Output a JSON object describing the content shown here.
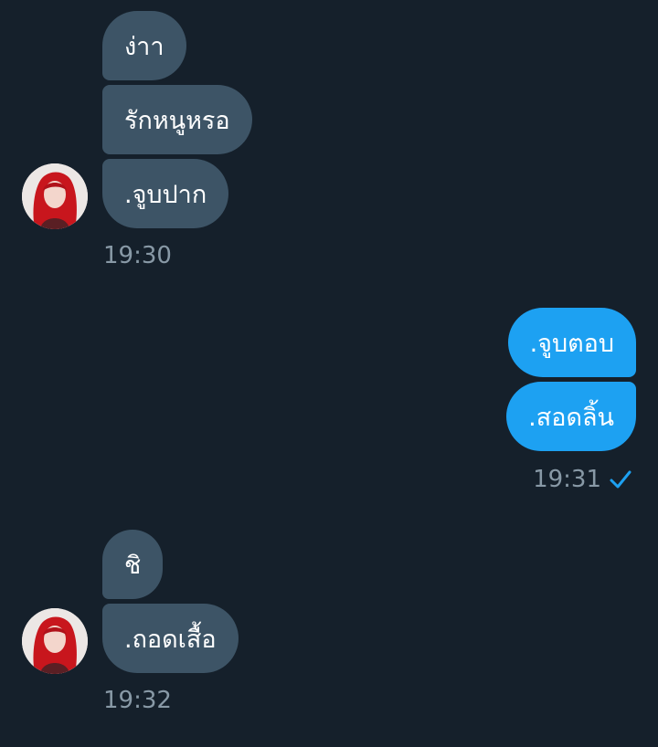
{
  "conversation": {
    "group1": {
      "messages": [
        "ง่าา",
        "รักหนูหรอ",
        ".จูบปาก"
      ],
      "time": "19:30"
    },
    "group2": {
      "messages": [
        ".จูบตอบ",
        ".สอดลิ้น"
      ],
      "time": "19:31",
      "status_icon": "check-icon"
    },
    "group3": {
      "messages": [
        "ชิ",
        ".ถอดเสื้อ"
      ],
      "time": "19:32"
    }
  },
  "colors": {
    "background": "#15202b",
    "incoming_bubble": "#3d5466",
    "outgoing_bubble": "#1da1f2",
    "timestamp": "#8899a6",
    "avatar_hair": "#c8161d"
  }
}
